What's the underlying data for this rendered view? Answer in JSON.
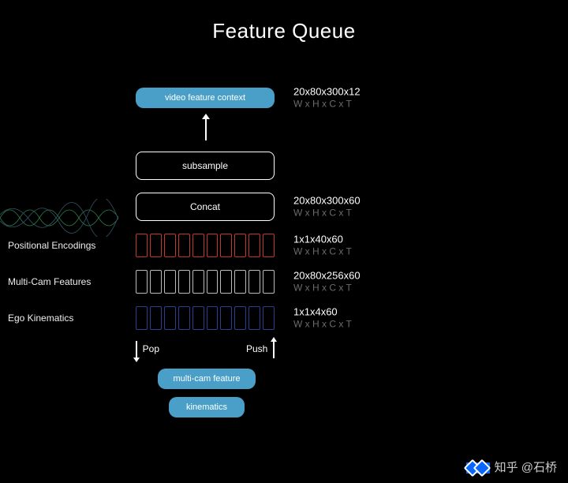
{
  "title": "Feature Queue",
  "output": {
    "label": "video feature context",
    "dims": "20x80x300x12",
    "dims_format": "W x H x C x T"
  },
  "subsample": {
    "label": "subsample"
  },
  "concat": {
    "label": "Concat",
    "dims": "20x80x300x60",
    "dims_format": "W x H x C x T"
  },
  "queues": {
    "positional": {
      "label": "Positional Encodings",
      "dims": "1x1x40x60",
      "dims_format": "W x H x C x T"
    },
    "multicam": {
      "label": "Multi-Cam Features",
      "dims": "20x80x256x60",
      "dims_format": "W x H x C x T"
    },
    "ego": {
      "label": "Ego Kinematics",
      "dims": "1x1x4x60",
      "dims_format": "W x H x C x T"
    },
    "slots": 10
  },
  "pop_label": "Pop",
  "push_label": "Push",
  "inputs": {
    "multicam": "multi-cam feature",
    "kinematics": "kinematics"
  },
  "watermark": "知乎 @石桥"
}
